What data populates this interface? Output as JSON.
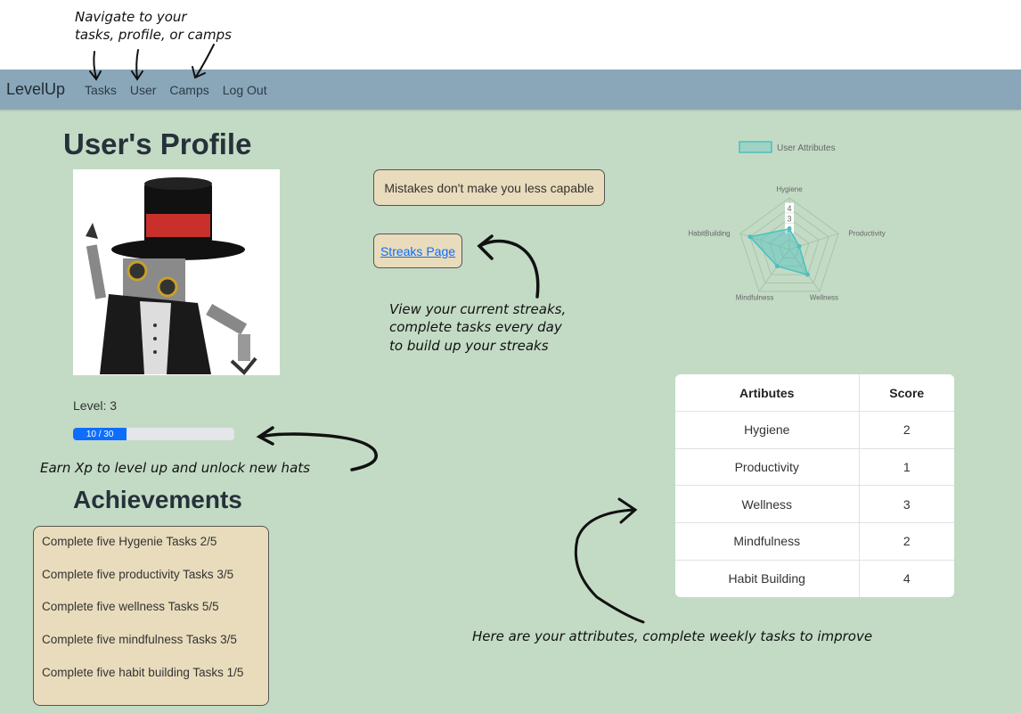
{
  "annotations": {
    "nav_line1": "Navigate to your",
    "nav_line2": "tasks, profile, or camps",
    "streak_line1": "View your current streaks,",
    "streak_line2": "complete tasks every day",
    "streak_line3": "to build up your streaks",
    "xp": "Earn Xp to level up and unlock new hats",
    "attributes": "Here are your attributes, complete weekly tasks to improve"
  },
  "navbar": {
    "brand": "LevelUp",
    "links": [
      "Tasks",
      "User",
      "Camps",
      "Log Out"
    ]
  },
  "profile": {
    "title": "User's Profile",
    "level_label": "Level: 3",
    "xp_text": "10 / 30",
    "xp_fraction": 0.333
  },
  "quote": "Mistakes don't make you less capable",
  "streaks_link": "Streaks Page",
  "achievements": {
    "title": "Achievements",
    "items": [
      "Complete five Hygenie Tasks 2/5",
      "Complete five productivity Tasks 3/5",
      "Complete five wellness Tasks 5/5",
      "Complete five mindfulness Tasks 3/5",
      "Complete five habit building Tasks 1/5"
    ]
  },
  "radar": {
    "legend": "User Attributes",
    "labels": [
      "Hygiene",
      "Productivity",
      "Wellness",
      "Mindfulness",
      "HabitBuilding"
    ],
    "values": [
      2,
      1,
      3,
      2,
      4
    ],
    "ticks": [
      "4",
      "3",
      "2"
    ],
    "color": "#4bc0c0"
  },
  "table": {
    "headers": [
      "Artibutes",
      "Score"
    ],
    "rows": [
      [
        "Hygiene",
        "2"
      ],
      [
        "Productivity",
        "1"
      ],
      [
        "Wellness",
        "3"
      ],
      [
        "Mindfulness",
        "2"
      ],
      [
        "Habit Building",
        "4"
      ]
    ]
  }
}
